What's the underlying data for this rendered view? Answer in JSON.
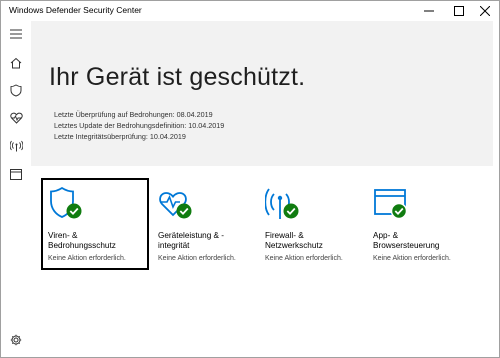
{
  "window": {
    "title": "Windows Defender Security Center"
  },
  "sidebar": {
    "items": [
      {
        "icon": "hamburger-menu-icon"
      },
      {
        "icon": "home-icon"
      },
      {
        "icon": "shield-icon"
      },
      {
        "icon": "heart-monitor-icon"
      },
      {
        "icon": "wireless-antenna-icon"
      },
      {
        "icon": "browser-window-icon"
      },
      {
        "icon": "gear-icon"
      }
    ]
  },
  "hero": {
    "title": "Ihr Gerät ist geschützt.",
    "last_scan": "Letzte Überprüfung auf Bedrohungen: 08.04.2019",
    "last_definition_update": "Letztes Update der Bedrohungsdefinition: 10.04.2019",
    "last_integrity_check": "Letzte Integritätsüberprüfung: 10.04.2019"
  },
  "tiles": [
    {
      "label": "Viren- &\nBedrohungsschutz",
      "status": "Keine Aktion erforderlich.",
      "icon": "shield-check-icon"
    },
    {
      "label": "Geräteleistung & -\nintegrität",
      "status": "Keine Aktion erforderlich.",
      "icon": "heart-check-icon"
    },
    {
      "label": "Firewall- &\nNetzwerkschutz",
      "status": "Keine Aktion erforderlich.",
      "icon": "antenna-check-icon"
    },
    {
      "label": "App- &\nBrowsersteuerung",
      "status": "Keine Aktion erforderlich.",
      "icon": "browser-check-icon"
    }
  ],
  "colors": {
    "accent": "#0078d7",
    "ok": "#107c10",
    "hero_bg": "#f2f2f2"
  }
}
